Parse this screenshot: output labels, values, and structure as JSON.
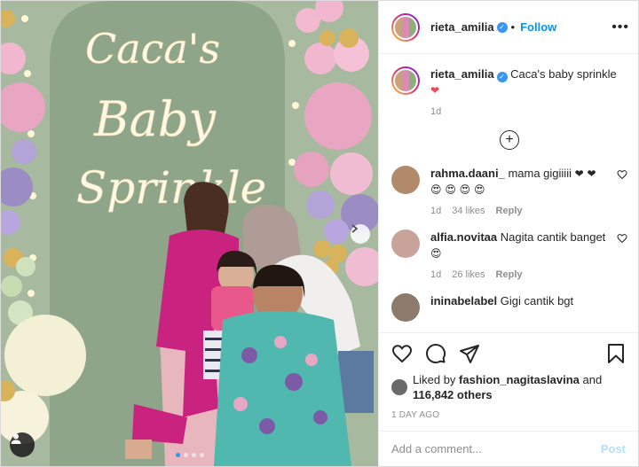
{
  "post": {
    "username": "rieta_amilia",
    "follow_label": "Follow",
    "more_label": "•••",
    "media_alt": "Caca's Baby Sprinkle",
    "sign_text": [
      "Caca's",
      "Baby",
      "Sprinkle"
    ],
    "carousel": {
      "current": 1,
      "total": 4
    }
  },
  "caption": {
    "username": "rieta_amilia",
    "text": "Caca's baby sprinkle",
    "emoji": "❤",
    "time": "1d"
  },
  "comments": [
    {
      "username": "rahma.daani_",
      "text": "mama gigiiiii",
      "emoji": "❤ ❤ 😍 😍 😍 😍",
      "time": "1d",
      "likes": "34 likes",
      "reply": "Reply",
      "avatar_color": "#b08a6a"
    },
    {
      "username": "alfia.novitaa",
      "text": "Nagita cantik banget",
      "emoji": "😍",
      "time": "1d",
      "likes": "26 likes",
      "reply": "Reply",
      "avatar_color": "#c7a39a"
    },
    {
      "username": "ininabelabel",
      "text": "Gigi cantik bgt",
      "emoji": "",
      "time": "",
      "likes": "",
      "reply": "",
      "avatar_color": "#8c7a6d"
    }
  ],
  "likes": {
    "prefix": "Liked by",
    "user": "fashion_nagitaslavina",
    "and": "and",
    "count": "116,842 others"
  },
  "timestamp": "1 DAY AGO",
  "comment_input": {
    "placeholder": "Add a comment...",
    "post_label": "Post"
  },
  "colors": {
    "accent": "#0095f6",
    "verified": "#3897f0",
    "heart": "#ed4956"
  }
}
